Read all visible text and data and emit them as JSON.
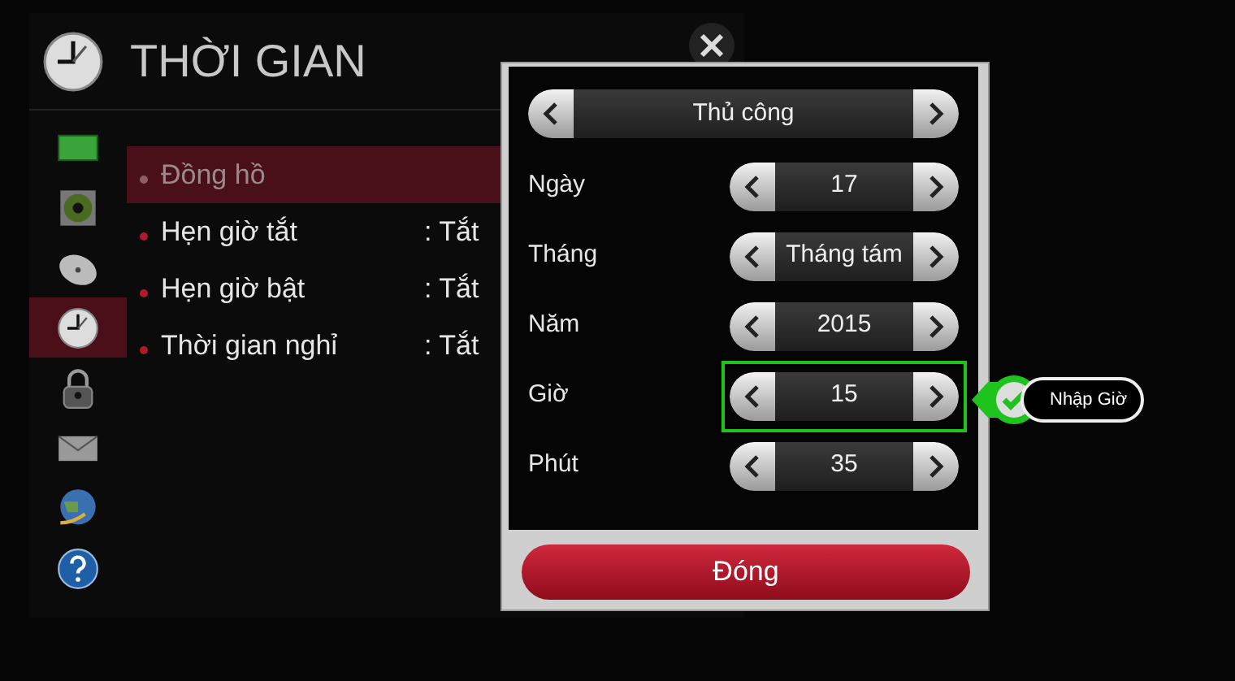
{
  "screen": {
    "title": "THỜI GIAN"
  },
  "sidebar_items": [
    {
      "kind": "screen",
      "selected": false
    },
    {
      "kind": "speaker",
      "selected": false
    },
    {
      "kind": "dish",
      "selected": false
    },
    {
      "kind": "clock",
      "selected": true
    },
    {
      "kind": "padlock",
      "selected": false
    },
    {
      "kind": "envelope",
      "selected": false
    },
    {
      "kind": "globe",
      "selected": false
    },
    {
      "kind": "question",
      "selected": false
    }
  ],
  "menu_items": [
    {
      "label": "Đồng hồ",
      "selected": true
    },
    {
      "label": "Hẹn giờ tắt",
      "value": ": Tắt",
      "selected": false
    },
    {
      "label": "Hẹn giờ bật",
      "value": ": Tắt",
      "selected": false
    },
    {
      "label": "Thời gian nghỉ",
      "value": ": Tắt",
      "selected": false
    }
  ],
  "dialog": {
    "mode": "Thủ công",
    "fields": [
      {
        "label": "Ngày",
        "value": "17",
        "highlighted": false
      },
      {
        "label": "Tháng",
        "value": "Tháng tám",
        "highlighted": false
      },
      {
        "label": "Năm",
        "value": "2015",
        "highlighted": false
      },
      {
        "label": "Giờ",
        "value": "15",
        "highlighted": true
      },
      {
        "label": "Phút",
        "value": "35",
        "highlighted": false
      }
    ],
    "close_button": "Đóng"
  },
  "callout": {
    "text": "Nhập Giờ"
  }
}
